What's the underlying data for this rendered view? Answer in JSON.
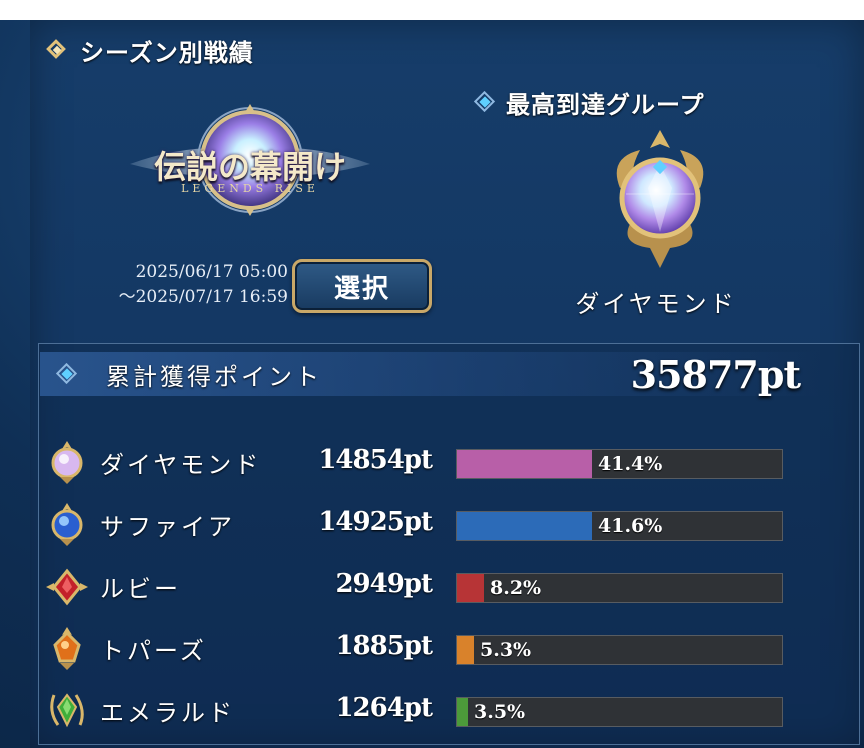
{
  "season": {
    "title": "シーズン別戦績",
    "logo_text": "伝説の幕開け",
    "logo_sub": "LEGENDS RISE",
    "date_start": "2025/06/17 05:00",
    "date_end": "～2025/07/17 16:59",
    "select_label": "選択"
  },
  "best_group": {
    "title": "最高到達グループ",
    "rank_name": "ダイヤモンド"
  },
  "points": {
    "title": "累計獲得ポイント",
    "total": "35877pt",
    "rows": [
      {
        "icon": "diamond-gem-icon",
        "name": "ダイヤモンド",
        "pts": "14854pt",
        "pct_label": "41.4%",
        "fraction": 0.414,
        "color": "#b85fa8"
      },
      {
        "icon": "sapphire-gem-icon",
        "name": "サファイア",
        "pts": "14925pt",
        "pct_label": "41.6%",
        "fraction": 0.416,
        "color": "#2c6bb8"
      },
      {
        "icon": "ruby-gem-icon",
        "name": "ルビー",
        "pts": "2949pt",
        "pct_label": "8.2%",
        "fraction": 0.082,
        "color": "#b73436"
      },
      {
        "icon": "topaz-gem-icon",
        "name": "トパーズ",
        "pts": "1885pt",
        "pct_label": "5.3%",
        "fraction": 0.053,
        "color": "#d9822b"
      },
      {
        "icon": "emerald-gem-icon",
        "name": "エメラルド",
        "pts": "1264pt",
        "pct_label": "3.5%",
        "fraction": 0.035,
        "color": "#4c9a3a"
      }
    ]
  }
}
